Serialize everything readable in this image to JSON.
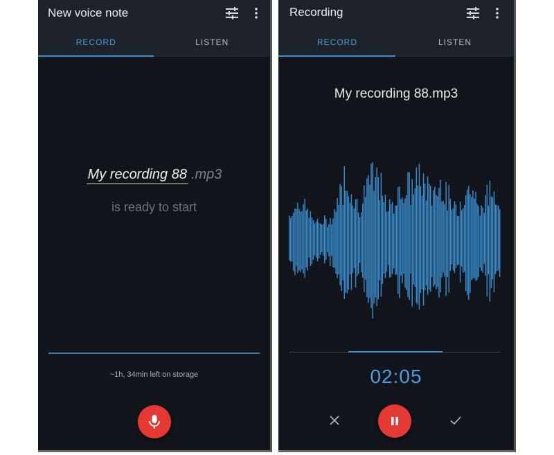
{
  "left": {
    "title": "New voice note",
    "tabs": [
      {
        "label": "RECORD"
      },
      {
        "label": "LISTEN"
      }
    ],
    "active_tab": "RECORD",
    "filename": "My recording 88",
    "extension": ".mp3",
    "status": "is ready to start",
    "storage": "~1h, 34min left on storage",
    "icons": {
      "settings": "tune-icon",
      "more": "more-vert-icon",
      "record": "mic-icon"
    }
  },
  "right": {
    "title": "Recording",
    "tabs": [
      {
        "label": "RECORD"
      },
      {
        "label": "LISTEN"
      }
    ],
    "active_tab": "RECORD",
    "recording_name": "My recording 88.mp3",
    "timer": "02:05",
    "icons": {
      "discard": "close-icon",
      "pause": "pause-icon",
      "save": "check-icon",
      "settings": "tune-icon",
      "more": "more-vert-icon"
    }
  },
  "colors": {
    "background": "#12161c",
    "bar": "#1e232b",
    "accent": "#3d95d6",
    "record_button": "#e53a33",
    "waveform": "#3b8fd0"
  }
}
